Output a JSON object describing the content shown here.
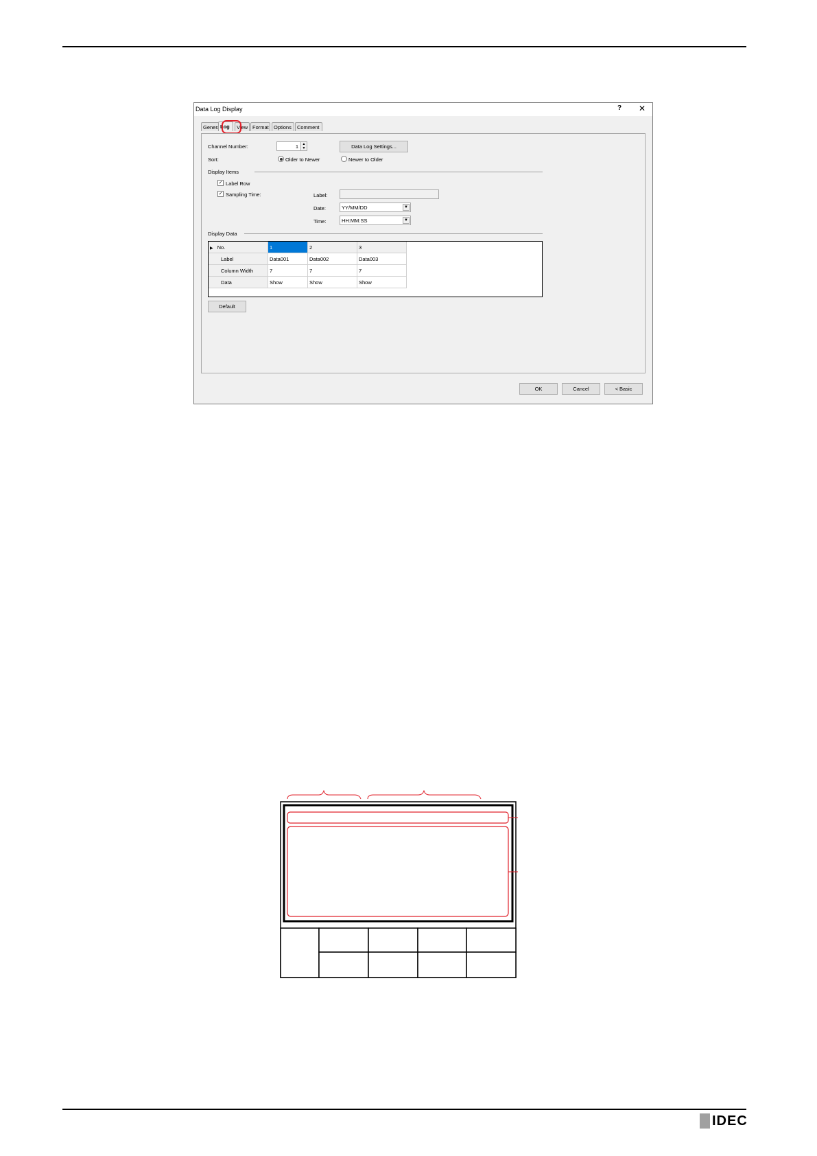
{
  "dialog": {
    "title": "Data Log Display",
    "help_label": "?",
    "close_label": "✕",
    "tabs": [
      "General",
      "Log",
      "View",
      "Format",
      "Options",
      "Comment"
    ],
    "channel_number": {
      "label": "Channel Number:",
      "value": "1"
    },
    "data_log_settings_button": "Data Log Settings...",
    "sort": {
      "label": "Sort:",
      "option_older": "Older to Newer",
      "option_newer": "Newer to Older",
      "selected": "Older to Newer"
    },
    "display_items": {
      "heading": "Display Items",
      "label_row": "Label Row",
      "sampling_time": "Sampling Time:",
      "label_field_label": "Label:",
      "label_field_value": "",
      "date_label": "Date:",
      "date_value": "YY/MM/DD",
      "time_label": "Time:",
      "time_value": "HH:MM:SS"
    },
    "display_data": {
      "heading": "Display Data",
      "rows": [
        {
          "header": "No.",
          "values": [
            "1",
            "2",
            "3"
          ]
        },
        {
          "header": "Label",
          "values": [
            "Data001",
            "Data002",
            "Data003"
          ]
        },
        {
          "header": "Column Width",
          "values": [
            "7",
            "7",
            "7"
          ]
        },
        {
          "header": "Data",
          "values": [
            "Show",
            "Show",
            "Show"
          ]
        }
      ]
    },
    "default_button": "Default",
    "ok_button": "OK",
    "cancel_button": "Cancel",
    "basic_button": "< Basic"
  },
  "footer": {
    "logo_text": "IDEC"
  },
  "colors": {
    "highlight": "#e0202a",
    "selection": "#0078d7"
  }
}
